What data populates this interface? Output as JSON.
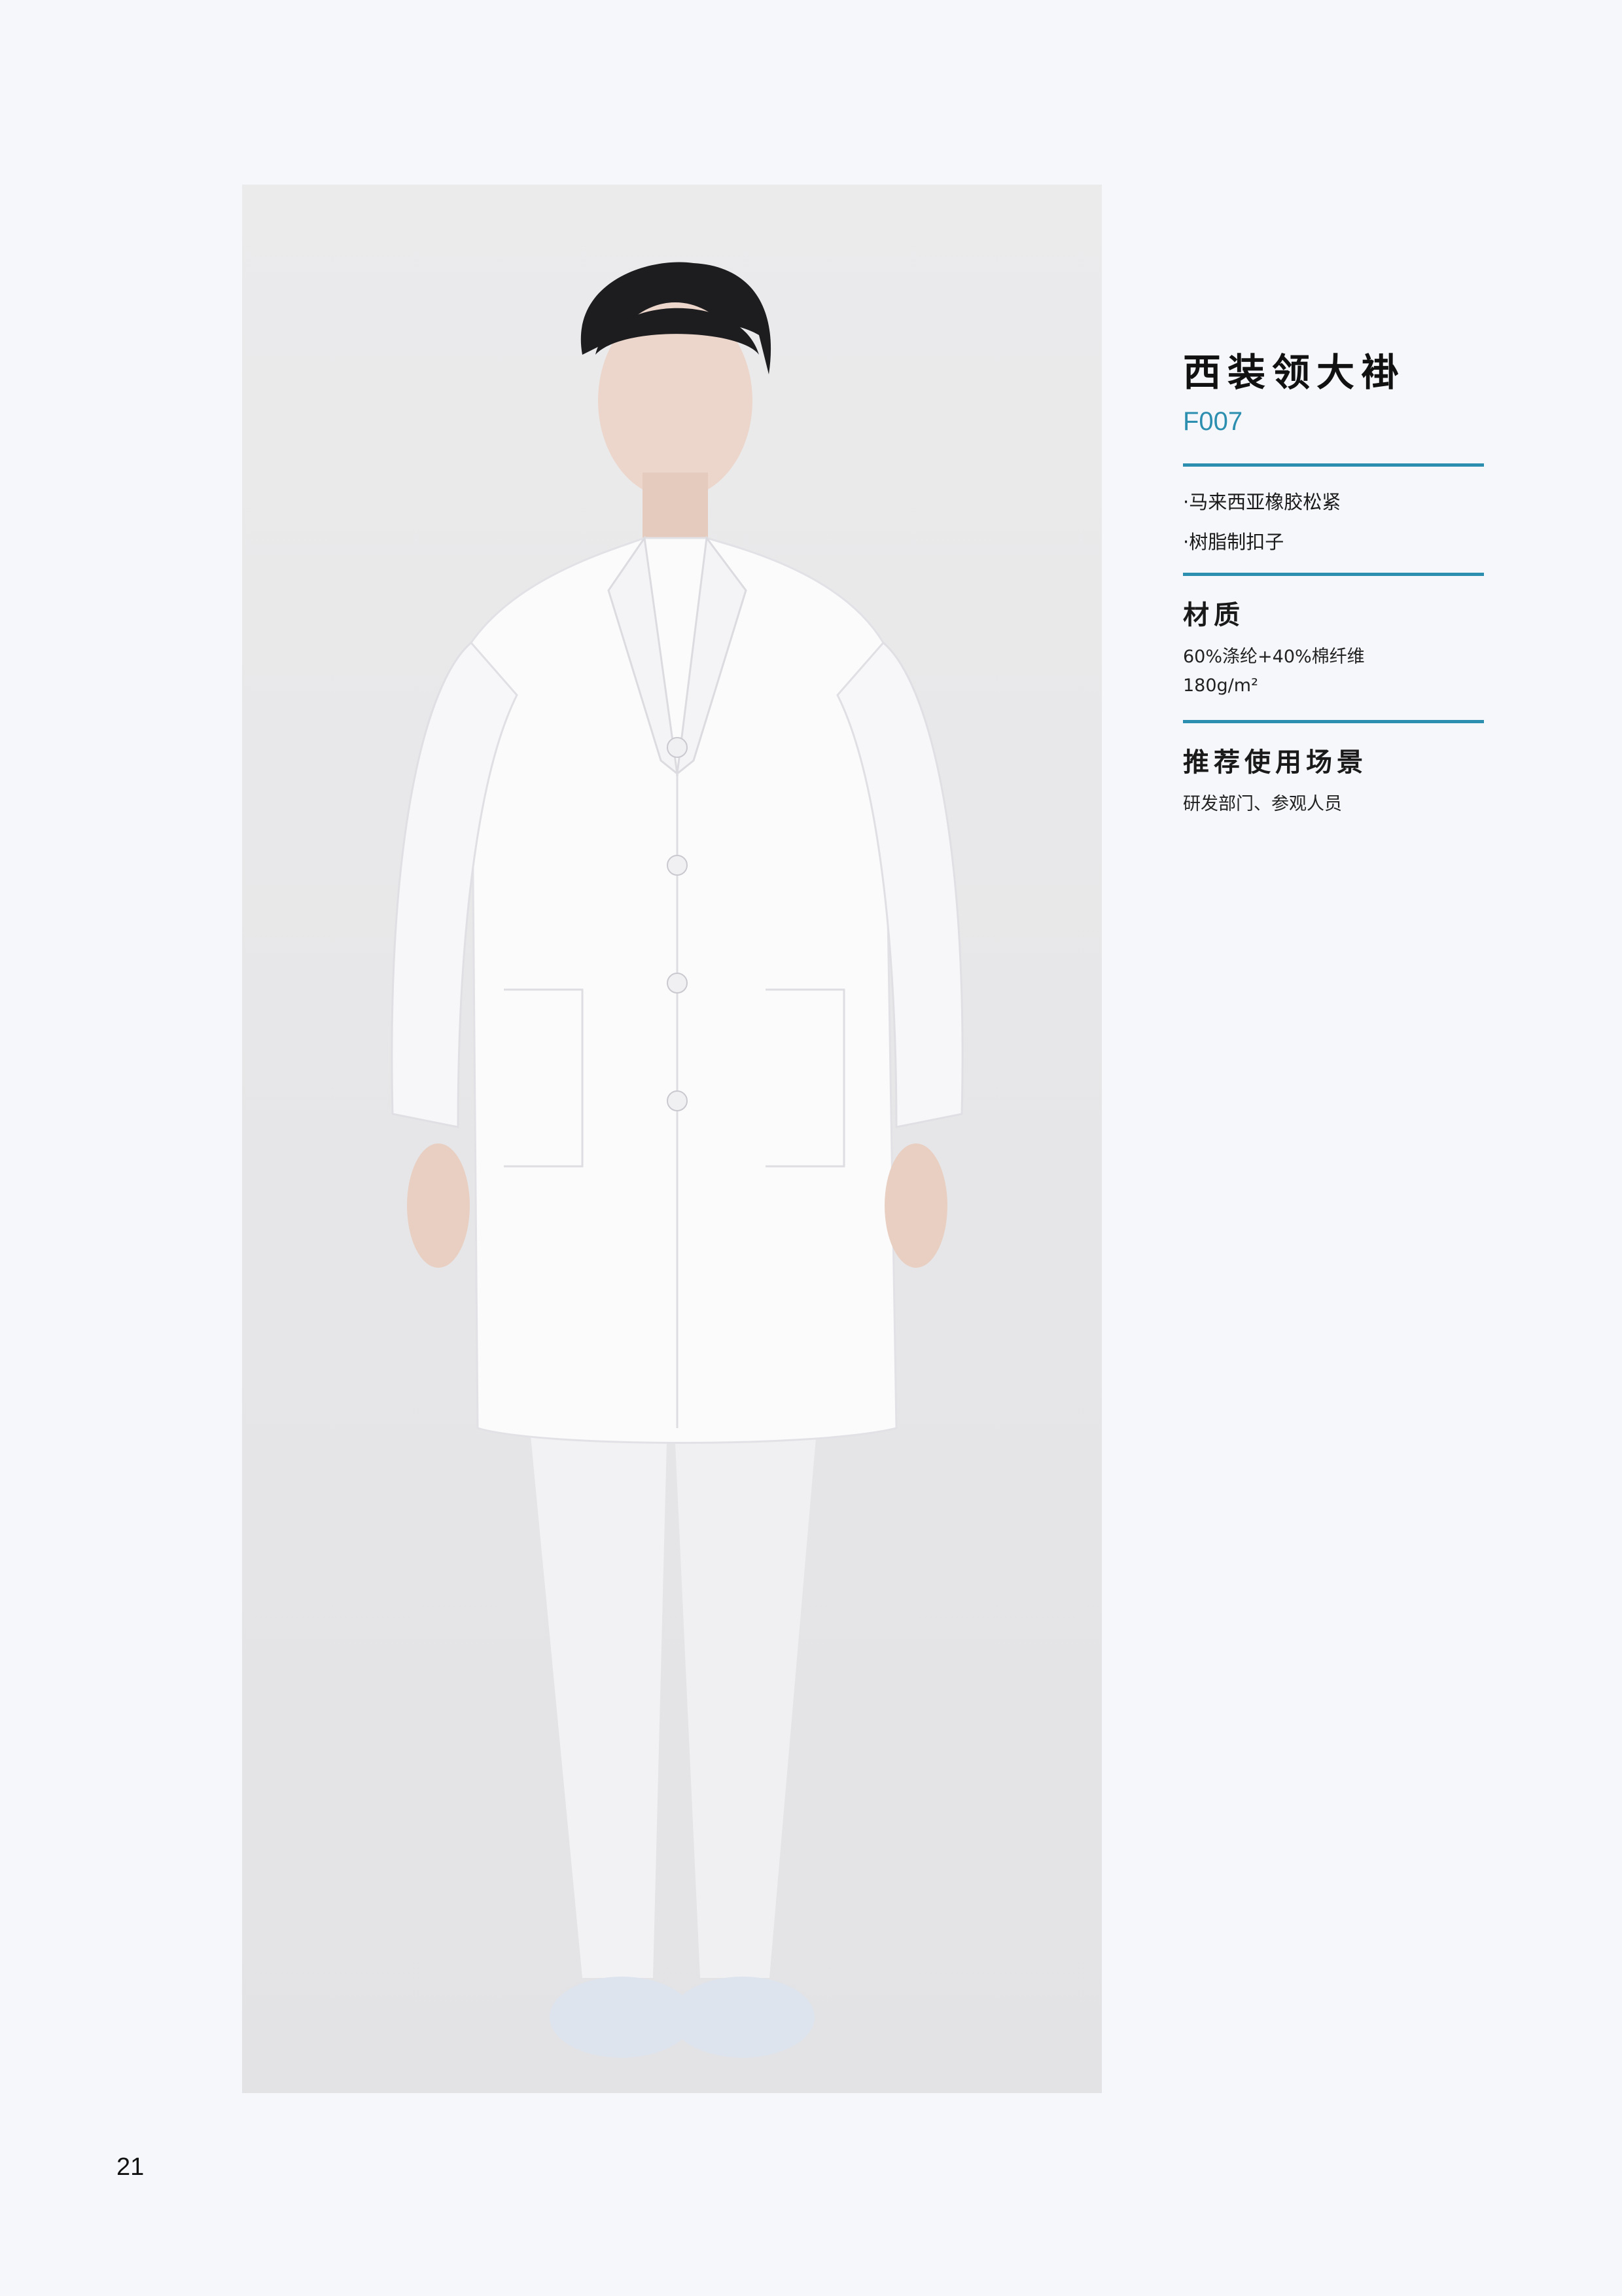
{
  "product": {
    "title": "西装领大褂",
    "code": "F007",
    "features": [
      "·马来西亚橡胶松紧",
      "·树脂制扣子"
    ]
  },
  "material": {
    "heading": "材质",
    "lines": [
      "60%涤纶+40%棉纤维",
      "180g/m²"
    ]
  },
  "usage": {
    "heading": "推荐使用场景",
    "text": "研发部门、参观人员"
  },
  "page_number": "21",
  "colors": {
    "accent": "#2d8fb0",
    "background": "#f5f7fb",
    "photo_background": "#e8e8ea"
  }
}
